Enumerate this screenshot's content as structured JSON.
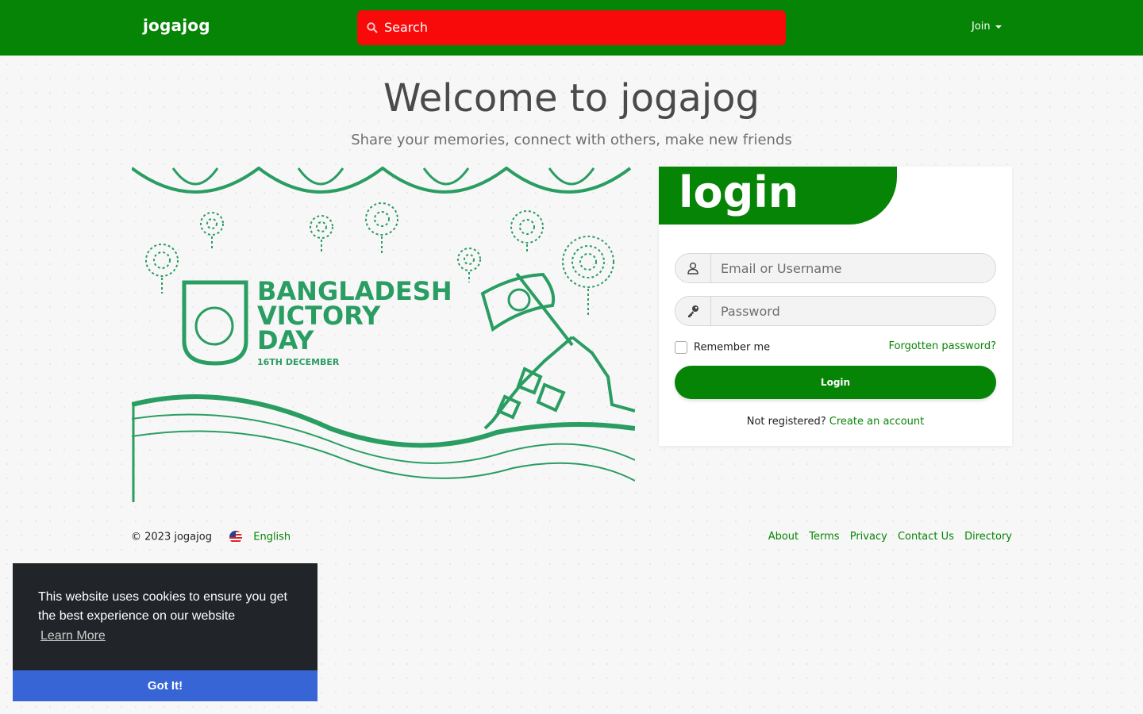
{
  "navbar": {
    "brand": "jogajog",
    "search_placeholder": "Search",
    "join_label": "Join"
  },
  "hero": {
    "title": "Welcome to jogajog",
    "subtitle": "Share your memories, connect with others, make new friends"
  },
  "illustration": {
    "line1": "BANGLADESH",
    "line2": "VICTORY",
    "line3": "DAY",
    "date": "16TH DECEMBER"
  },
  "login": {
    "title": "login",
    "email_placeholder": "Email or Username",
    "password_placeholder": "Password",
    "remember_label": "Remember me",
    "forgot_label": "Forgotten password?",
    "submit_label": "Login",
    "not_registered": "Not registered?",
    "create_account": "Create an account"
  },
  "footer": {
    "copyright": "© 2023 jogajog",
    "language": "English",
    "links": [
      "About",
      "Terms",
      "Privacy",
      "Contact Us",
      "Directory"
    ]
  },
  "cookie": {
    "message": "This website uses cookies to ensure you get the best experience on our website",
    "learn_more": "Learn More",
    "accept": "Got It!"
  },
  "colors": {
    "brand_green": "#068406",
    "search_red": "#f80a0a",
    "illustration_green": "#2a9d62",
    "cookie_bg": "#212529",
    "cookie_button": "#3765d6"
  },
  "icons": [
    "search-icon",
    "user-icon",
    "key-icon",
    "us-flag-icon",
    "caret-down-icon"
  ]
}
